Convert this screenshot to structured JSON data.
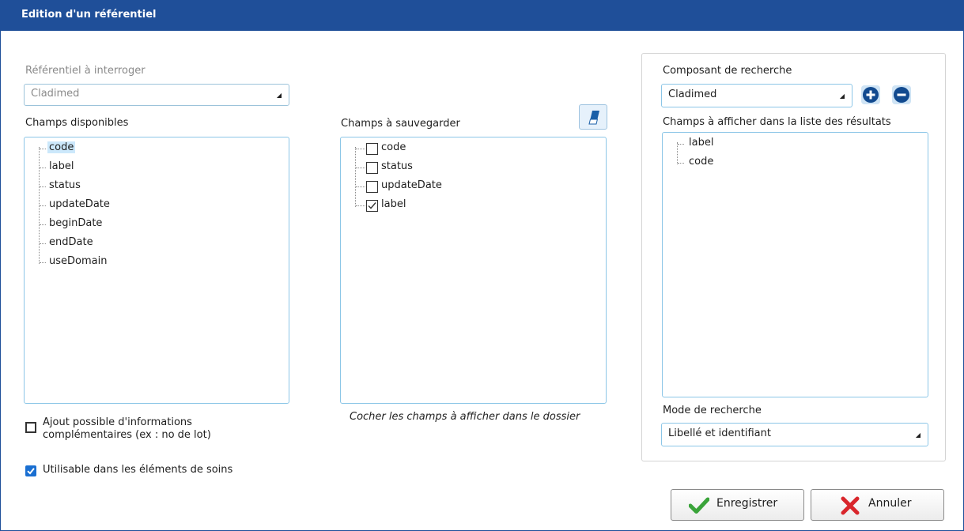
{
  "window": {
    "title": "Edition d'un référentiel"
  },
  "left": {
    "referentiel_label": "Référentiel à interroger",
    "referentiel_value": "Cladimed",
    "fields_label": "Champs disponibles",
    "fields": [
      "code",
      "label",
      "status",
      "updateDate",
      "beginDate",
      "endDate",
      "useDomain"
    ],
    "selected_field": "code",
    "option_extra_info": "Ajout possible d'informations\ncomplémentaires (ex : no de lot)",
    "option_extra_info_checked": false,
    "option_soins": "Utilisable dans les éléments de soins",
    "option_soins_checked": true
  },
  "middle": {
    "fields_label": "Champs à sauvegarder",
    "fields": [
      {
        "label": "code",
        "checked": false
      },
      {
        "label": "status",
        "checked": false
      },
      {
        "label": "updateDate",
        "checked": false
      },
      {
        "label": "label",
        "checked": true
      }
    ],
    "hint": "Cocher les champs à afficher dans le dossier",
    "clear_icon": "eraser-icon"
  },
  "right": {
    "component_label": "Composant de recherche",
    "component_value": "Cladimed",
    "add_icon": "plus-circle-icon",
    "remove_icon": "minus-circle-icon",
    "result_fields_label": "Champs à afficher dans la liste des résultats",
    "result_fields": [
      "label",
      "code"
    ],
    "mode_label": "Mode de recherche",
    "mode_value": "Libellé et identifiant"
  },
  "buttons": {
    "save_label": "Enregistrer",
    "cancel_label": "Annuler",
    "save_icon": "check-icon",
    "cancel_icon": "x-icon"
  },
  "colors": {
    "titlebar": "#1f4f99",
    "border_accent": "#8cc6e7",
    "check_green": "#3aa43a",
    "cancel_red": "#d9262c",
    "checkbox_blue": "#1a6fd1"
  }
}
